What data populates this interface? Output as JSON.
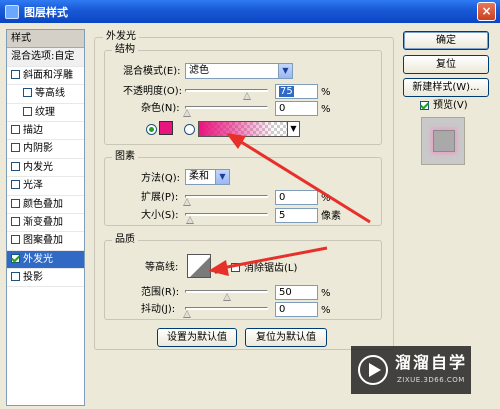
{
  "window": {
    "title": "图层样式",
    "close_glyph": "×"
  },
  "sidebar": {
    "header": "样式",
    "blend_options": "混合选项:自定",
    "items": [
      {
        "label": "斜面和浮雕",
        "checked": false
      },
      {
        "label": "等高线",
        "checked": false
      },
      {
        "label": "纹理",
        "checked": false
      },
      {
        "label": "描边",
        "checked": false
      },
      {
        "label": "内阴影",
        "checked": false
      },
      {
        "label": "内发光",
        "checked": false
      },
      {
        "label": "光泽",
        "checked": false
      },
      {
        "label": "颜色叠加",
        "checked": false
      },
      {
        "label": "渐变叠加",
        "checked": false
      },
      {
        "label": "图案叠加",
        "checked": false
      },
      {
        "label": "外发光",
        "checked": true,
        "selected": true
      },
      {
        "label": "投影",
        "checked": false
      }
    ]
  },
  "panel": {
    "title": "外发光",
    "structure": {
      "title": "结构",
      "blend_mode_label": "混合模式(E):",
      "blend_mode_value": "滤色",
      "opacity_label": "不透明度(O):",
      "opacity_value": "75",
      "opacity_unit": "%",
      "opacity_fraction": 0.75,
      "noise_label": "杂色(N):",
      "noise_value": "0",
      "noise_unit": "%",
      "glow_color": "#e8157e"
    },
    "elements": {
      "title": "图素",
      "technique_label": "方法(Q):",
      "technique_value": "柔和",
      "spread_label": "扩展(P):",
      "spread_value": "0",
      "spread_unit": "%",
      "size_label": "大小(S):",
      "size_value": "5",
      "size_unit": "像素"
    },
    "quality": {
      "title": "品质",
      "contour_label": "等高线:",
      "anti_alias_label": "消除锯齿(L)",
      "range_label": "范围(R):",
      "range_value": "50",
      "range_unit": "%",
      "jitter_label": "抖动(J):",
      "jitter_value": "0",
      "jitter_unit": "%"
    },
    "make_default": "设置为默认值",
    "reset_default": "复位为默认值"
  },
  "actions": {
    "ok": "确定",
    "reset": "复位",
    "new_style": "新建样式(W)...",
    "preview_label": "预览(V)"
  },
  "watermark": {
    "main": "溜溜自学",
    "sub": "ZIXUE.3D66.COM"
  },
  "colors": {
    "accent": "#316ac5",
    "annotation": "#e8302a",
    "glow": "#e8157e"
  }
}
